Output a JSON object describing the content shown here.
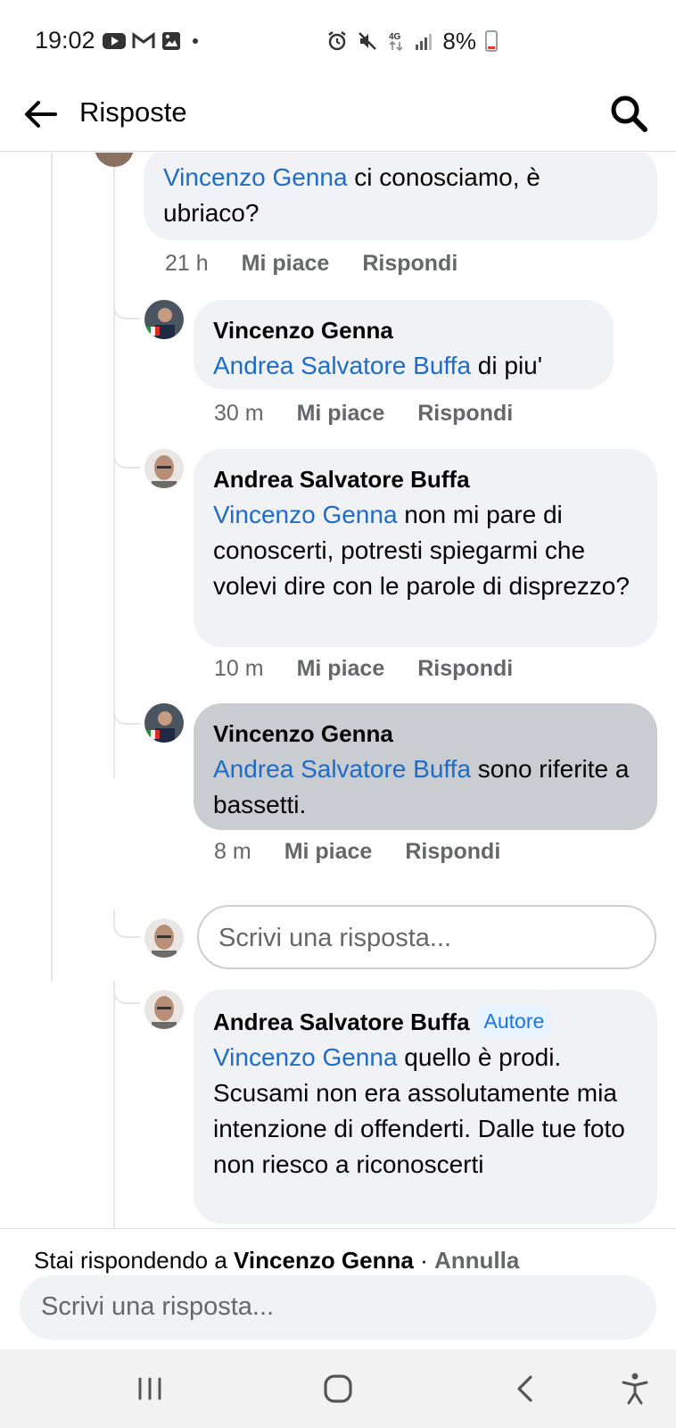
{
  "status_bar": {
    "time": "19:02",
    "battery_percent": "8%",
    "left_icons": [
      "youtube-icon",
      "gmail-icon",
      "gallery-icon",
      "dot-icon"
    ],
    "right_icons": [
      "alarm-icon",
      "mute-icon",
      "4g-icon",
      "signal-icon",
      "battery-icon"
    ]
  },
  "header": {
    "title": "Risposte"
  },
  "comments": [
    {
      "author": "",
      "mention": "Vincenzo Genna",
      "text": " ci conosciamo, è ubriaco?",
      "time": "21 h",
      "like": "Mi piace",
      "reply": "Rispondi"
    },
    {
      "author": "Vincenzo Genna",
      "mention": "Andrea Salvatore Buffa",
      "text": " di piu'",
      "time": "30 m",
      "like": "Mi piace",
      "reply": "Rispondi"
    },
    {
      "author": "Andrea Salvatore Buffa",
      "mention": "Vincenzo Genna",
      "text": " non mi pare di conoscerti, potresti spiegarmi che volevi dire con le parole di disprezzo?",
      "time": "10 m",
      "like": "Mi piace",
      "reply": "Rispondi"
    },
    {
      "author": "Vincenzo Genna",
      "mention": "Andrea Salvatore Buffa",
      "text": " sono riferite a bassetti.",
      "time": "8 m",
      "like": "Mi piace",
      "reply": "Rispondi"
    },
    {
      "author": "Andrea Salvatore Buffa",
      "badge": "Autore",
      "mention": "Vincenzo Genna",
      "text": " quello è prodi. Scusami non era assolutamente mia intenzione di offenderti. Dalle tue foto non riesco a riconoscerti"
    }
  ],
  "inline_reply": {
    "placeholder": "Scrivi una risposta..."
  },
  "composer": {
    "replying_prefix": "Stai rispondendo a ",
    "replying_to": "Vincenzo Genna",
    "separator": " · ",
    "cancel": "Annulla",
    "placeholder": "Scrivi una risposta..."
  },
  "colors": {
    "mention": "#1e6cc8",
    "bubble": "#f0f2f5",
    "bubble_highlight": "#c9ccd1",
    "meta": "#65676b",
    "badge_bg": "#e7f3ff",
    "badge_text": "#1b74e4"
  },
  "nav_bar": {
    "icons": [
      "recent-apps-icon",
      "home-icon",
      "back-nav-icon",
      "accessibility-icon"
    ]
  }
}
